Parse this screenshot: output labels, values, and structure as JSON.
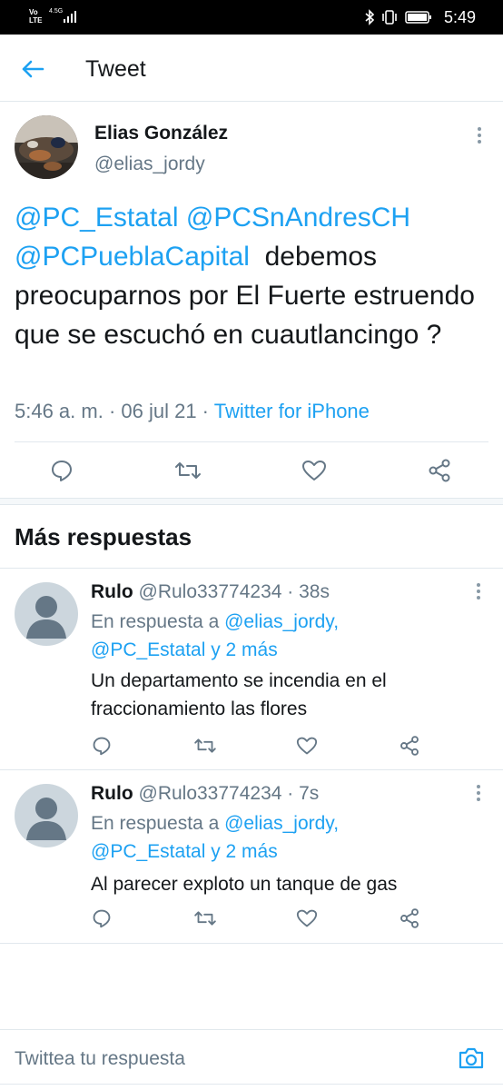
{
  "status_bar": {
    "carrier_top": "Vo",
    "carrier_bottom": "LTE",
    "network": "4.5G",
    "time": "5:49"
  },
  "header": {
    "title": "Tweet",
    "back_icon": "arrow-left-icon"
  },
  "tweet": {
    "author_name": "Elias González",
    "author_handle": "@elias_jordy",
    "mentions": [
      "@PC_Estatal",
      "@PCSnAndresCH",
      "@PCPueblaCapital"
    ],
    "body": "debemos preocuparnos por El Fuerte estruendo que se escuchó en cuautlancingo ?",
    "timestamp": "5:46 a. m. · 06 jul 21 · ",
    "source": "Twitter for iPhone",
    "actions": [
      "reply-icon",
      "retweet-icon",
      "like-icon",
      "share-icon"
    ]
  },
  "more_replies": {
    "title": "Más respuestas",
    "replies": [
      {
        "name": "Rulo",
        "handle": "@Rulo33774234",
        "time": " · 38s",
        "reply_prefix": "En respuesta a ",
        "reply_to_1": "@elias_jordy,",
        "reply_to_2": "@PC_Estatal y 2 más",
        "text": "Un departamento se incendia en el fraccionamiento las flores"
      },
      {
        "name": "Rulo",
        "handle": "@Rulo33774234",
        "time": " · 7s",
        "reply_prefix": "En respuesta a ",
        "reply_to_1": "@elias_jordy,",
        "reply_to_2": "@PC_Estatal y 2 más",
        "text": "Al parecer exploto un tanque de gas"
      }
    ]
  },
  "compose": {
    "placeholder": "Twittea tu respuesta",
    "camera_icon": "camera-icon"
  },
  "colors": {
    "accent": "#1da1f2",
    "text": "#14171a",
    "muted": "#657786",
    "divider": "#e1e8ed"
  }
}
